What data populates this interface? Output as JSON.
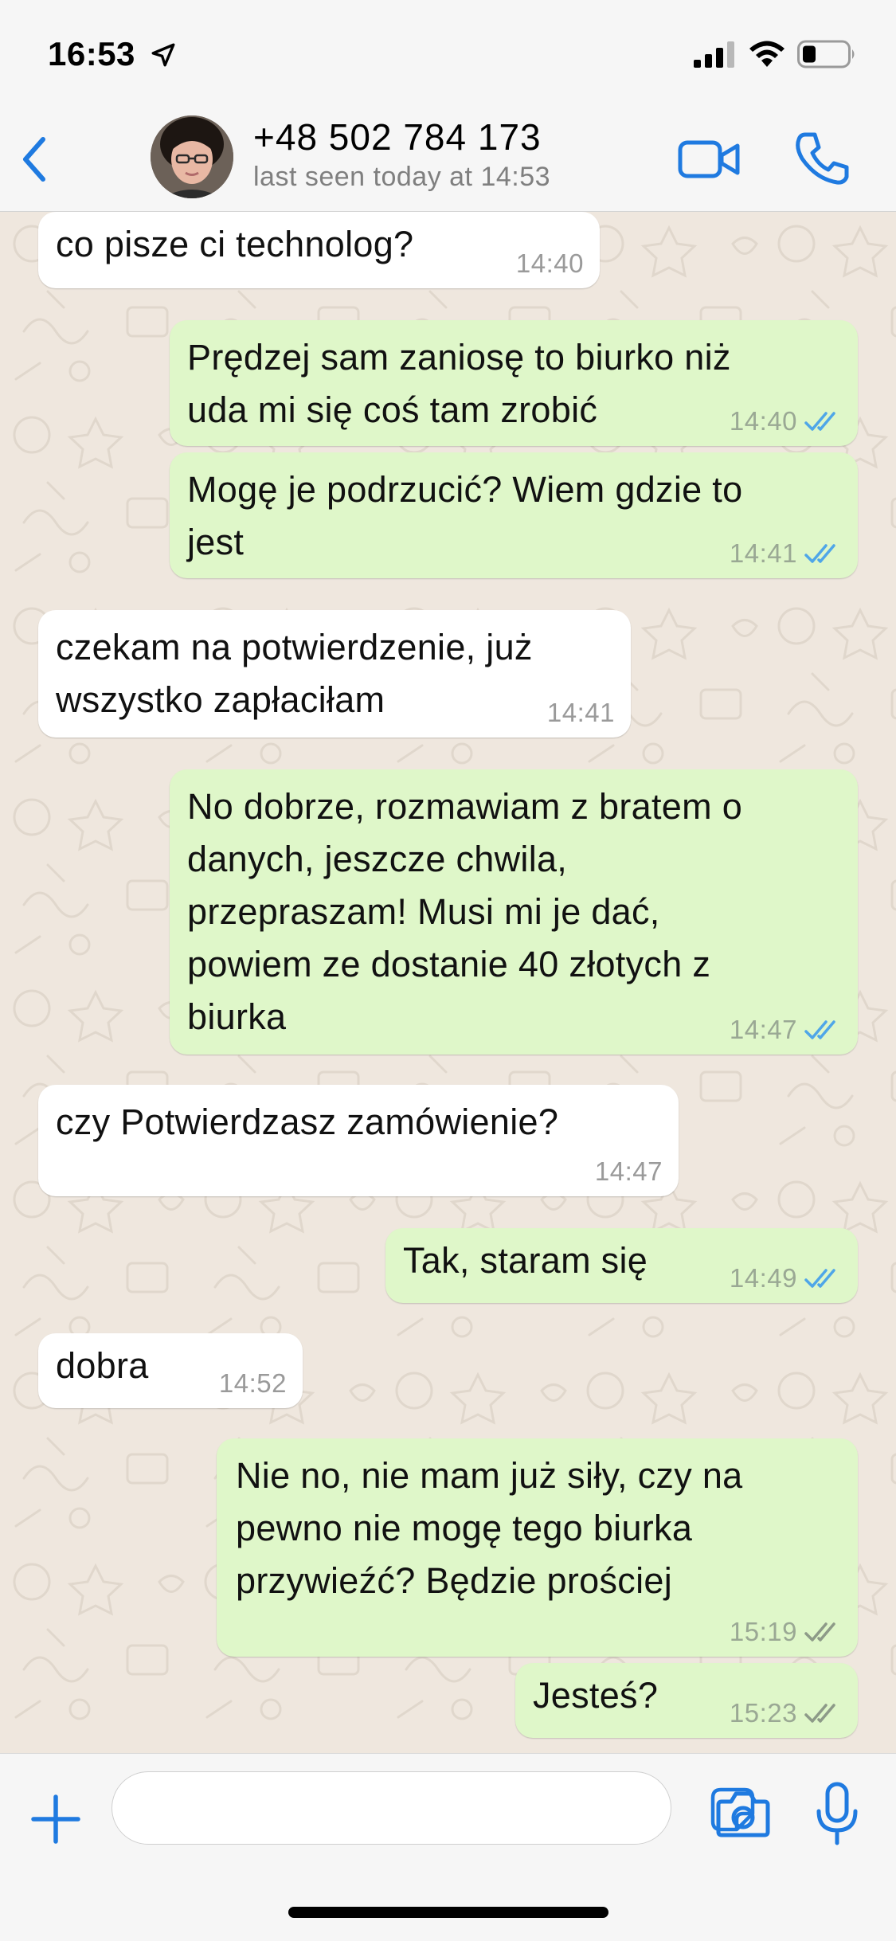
{
  "status_bar": {
    "time": "16:53"
  },
  "header": {
    "contact_name": "+48 502 784 173",
    "last_seen": "last seen today at 14:53"
  },
  "colors": {
    "accent": "#1f7ae0",
    "outgoing_bubble": "#dff7c9",
    "incoming_bubble": "#ffffff",
    "read_tick": "#4fa6e8",
    "delivered_tick": "#8d9a88",
    "chat_background": "#efe7de"
  },
  "messages": [
    {
      "direction": "in",
      "text": "co pisze ci technolog?",
      "time": "14:40"
    },
    {
      "direction": "out",
      "text": "Prędzej sam zaniosę to biurko niż\nuda mi się coś tam zrobić",
      "time": "14:40",
      "status": "read"
    },
    {
      "direction": "out",
      "text": "Mogę je podrzucić? Wiem gdzie to\njest",
      "time": "14:41",
      "status": "read"
    },
    {
      "direction": "in",
      "text": "czekam na potwierdzenie, już\nwszystko zapłaciłam",
      "time": "14:41"
    },
    {
      "direction": "out",
      "text": "No dobrze, rozmawiam z bratem o\ndanych, jeszcze chwila,\nprzepraszam! Musi mi je dać,\npowiem ze dostanie 40 złotych z\nbiurka",
      "time": "14:47",
      "status": "read"
    },
    {
      "direction": "in",
      "text": "czy Potwierdzasz zamówienie?",
      "time": "14:47"
    },
    {
      "direction": "out",
      "text": "Tak, staram się",
      "time": "14:49",
      "status": "read"
    },
    {
      "direction": "in",
      "text": "dobra",
      "time": "14:52"
    },
    {
      "direction": "out",
      "text": "Nie no, nie mam już siły, czy na\npewno nie mogę tego biurka\nprzywieźć? Będzie prościej",
      "time": "15:19",
      "status": "delivered"
    },
    {
      "direction": "out",
      "text": "Jesteś?",
      "time": "15:23",
      "status": "delivered"
    }
  ],
  "composer": {
    "input_value": ""
  }
}
